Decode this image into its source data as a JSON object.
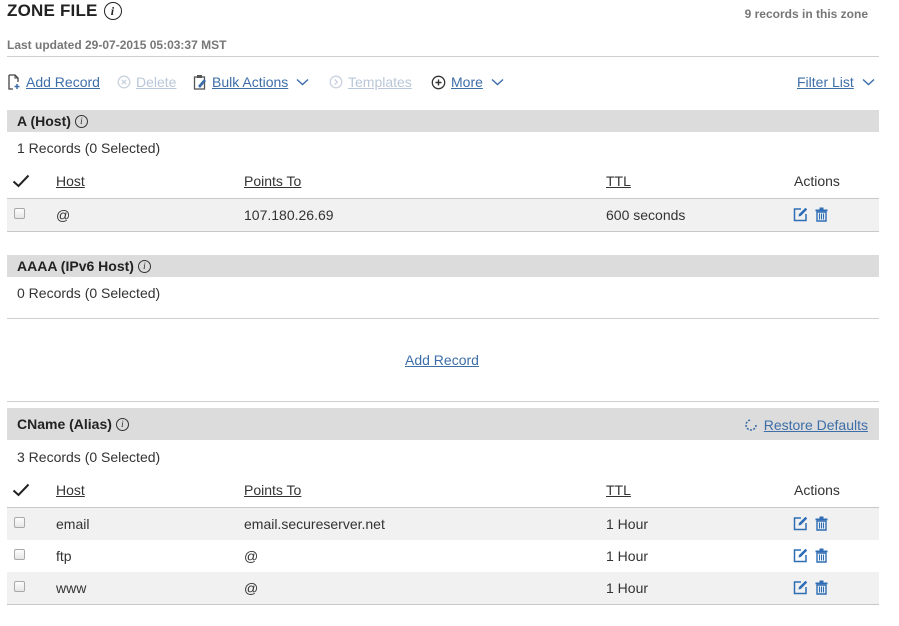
{
  "header": {
    "title": "ZONE FILE",
    "info_glyph": "i",
    "records_in_zone": "9 records in this zone",
    "last_updated": "Last updated 29-07-2015 05:03:37 MST"
  },
  "toolbar": {
    "add_record": "Add Record",
    "delete": "Delete",
    "bulk_actions": "Bulk Actions",
    "templates": "Templates",
    "more": "More",
    "filter_list": "Filter List"
  },
  "columns": {
    "host": "Host",
    "points_to": "Points To",
    "ttl": "TTL",
    "actions": "Actions"
  },
  "sections": {
    "a_host": {
      "title": "A (Host)",
      "count": "1 Records (0 Selected)",
      "rows": [
        {
          "host": "@",
          "points_to": "107.180.26.69",
          "ttl": "600 seconds"
        }
      ]
    },
    "aaaa": {
      "title": "AAAA (IPv6 Host)",
      "count": "0 Records (0 Selected)",
      "add_record": "Add Record"
    },
    "cname": {
      "title": "CName (Alias)",
      "count": "3 Records (0 Selected)",
      "restore_defaults": "Restore Defaults",
      "rows": [
        {
          "host": "email",
          "points_to": "email.secureserver.net",
          "ttl": "1 Hour"
        },
        {
          "host": "ftp",
          "points_to": "@",
          "ttl": "1 Hour"
        },
        {
          "host": "www",
          "points_to": "@",
          "ttl": "1 Hour"
        }
      ]
    }
  },
  "colors": {
    "link": "#3d6ea8",
    "link_disabled": "#b9c7d8",
    "section_header_bg": "#dcdcdc",
    "row_alt_bg": "#f1f1f1",
    "action_icon": "#2f6db5"
  },
  "icons": {
    "add_record": "document-add-icon",
    "delete": "circle-x-icon",
    "bulk_actions": "clipboard-edit-icon",
    "templates": "circle-arrow-icon",
    "more": "circle-plus-icon",
    "chevron": "chevron-down-icon",
    "select_all": "checkmark-icon",
    "edit": "edit-pencil-icon",
    "trash": "trash-icon",
    "restore": "refresh-icon"
  }
}
